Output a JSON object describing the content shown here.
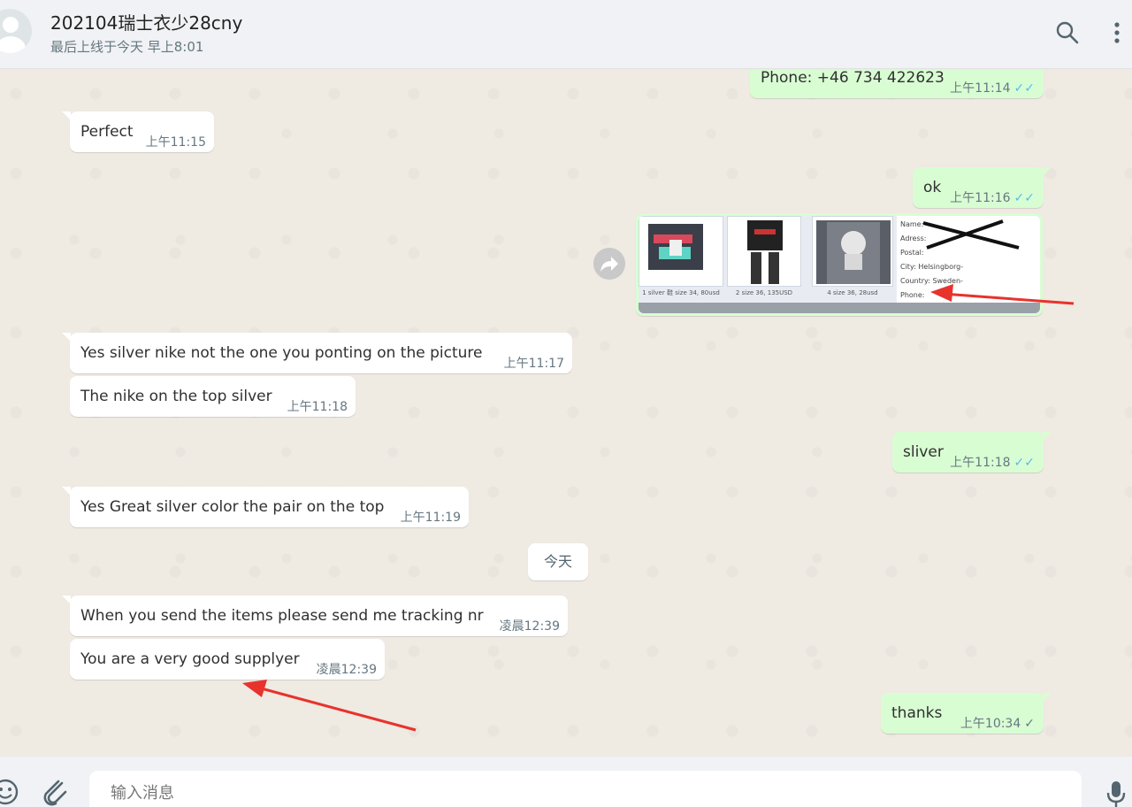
{
  "header": {
    "title": "202104瑞士衣少28cny",
    "status": "最后上线于今天 早上8:01"
  },
  "messages": [
    {
      "side": "out",
      "text": "Phone: +46 734 422623",
      "time": "上午11:14",
      "ticks": "✓✓",
      "read": true
    },
    {
      "side": "in",
      "text": "Perfect",
      "time": "上午11:15"
    },
    {
      "side": "out",
      "text": "ok",
      "time": "上午11:16",
      "ticks": "✓✓",
      "read": true
    },
    {
      "side": "in",
      "text": "Yes silver nike not the one you ponting on the picture",
      "time": "上午11:17"
    },
    {
      "side": "in",
      "text": "The nike on the top silver",
      "time": "上午11:18"
    },
    {
      "side": "out",
      "text": "sliver",
      "time": "上午11:18",
      "ticks": "✓✓",
      "read": true
    },
    {
      "side": "in",
      "text": "Yes Great silver color the pair on the top",
      "time": "上午11:19"
    },
    {
      "side": "in",
      "text": "When you send the items please send me tracking nr",
      "time": "凌晨12:39"
    },
    {
      "side": "in",
      "text": "You are a very good supplyer",
      "time": "凌晨12:39"
    },
    {
      "side": "out",
      "text": "thanks",
      "time": "上午10:34",
      "ticks": "✓",
      "read": false
    }
  ],
  "day_separator": "今天",
  "image_message": {
    "thumb_captions": [
      "1 silver 鞋 size 34, 80usd",
      "2 size 36, 135USD",
      "4 size 36, 28usd"
    ],
    "address_lines": [
      "Name:",
      "Adress:",
      "Postal:",
      "City: Helsingborg-",
      "Country: Sweden-",
      "Phone:"
    ]
  },
  "input": {
    "placeholder": "输入消息"
  },
  "colors": {
    "outgoing_bubble": "#d9fdd3",
    "incoming_bubble": "#ffffff",
    "read_tick": "#53bdeb",
    "annotation_arrow": "#e8322c"
  },
  "icons": {
    "search": "search-icon",
    "menu": "menu-icon",
    "forward": "forward-icon",
    "emoji": "emoji-icon",
    "attach": "attach-icon",
    "mic": "mic-icon"
  }
}
